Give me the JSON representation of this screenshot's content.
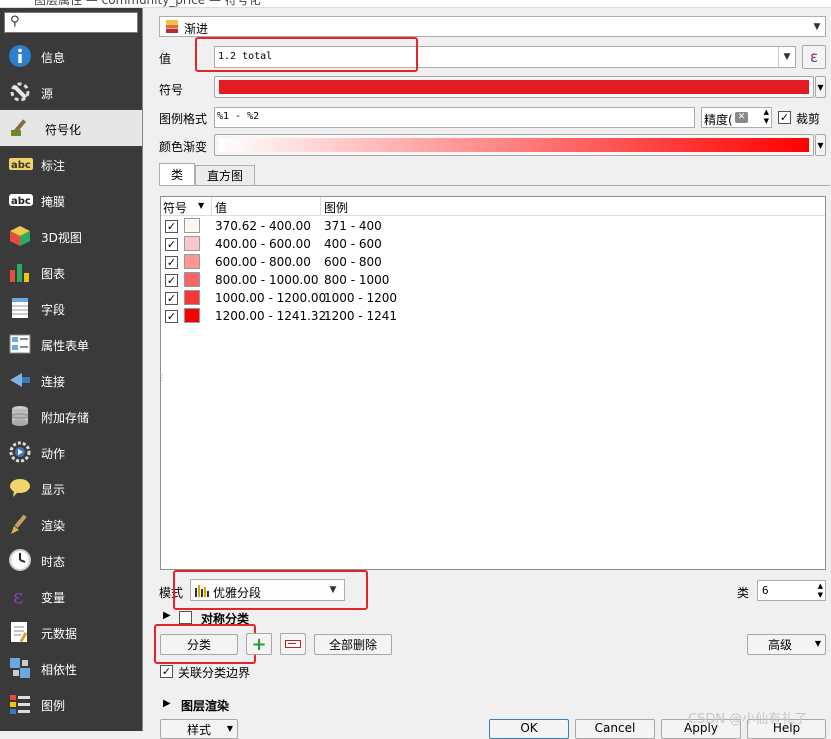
{
  "window": {
    "title_fragment": "图层属性 — community_price — 符号化"
  },
  "sidebar": {
    "search_placeholder": "",
    "items": [
      {
        "label": "信息",
        "icon": "info-icon"
      },
      {
        "label": "源",
        "icon": "source-wrench-icon"
      },
      {
        "label": "符号化",
        "icon": "symbology-brush-icon"
      },
      {
        "label": "标注",
        "icon": "labels-abc-icon"
      },
      {
        "label": "掩膜",
        "icon": "mask-abc-icon"
      },
      {
        "label": "3D视图",
        "icon": "3d-cube-icon"
      },
      {
        "label": "图表",
        "icon": "diagram-chart-icon"
      },
      {
        "label": "字段",
        "icon": "fields-table-icon"
      },
      {
        "label": "属性表单",
        "icon": "attributes-form-icon"
      },
      {
        "label": "连接",
        "icon": "joins-icon"
      },
      {
        "label": "附加存储",
        "icon": "auxiliary-storage-icon"
      },
      {
        "label": "动作",
        "icon": "actions-gear-icon"
      },
      {
        "label": "显示",
        "icon": "display-bubble-icon"
      },
      {
        "label": "渲染",
        "icon": "rendering-brush-icon"
      },
      {
        "label": "时态",
        "icon": "temporal-clock-icon"
      },
      {
        "label": "变量",
        "icon": "variables-epsilon-icon"
      },
      {
        "label": "元数据",
        "icon": "metadata-doc-icon"
      },
      {
        "label": "相依性",
        "icon": "dependencies-icon"
      },
      {
        "label": "图例",
        "icon": "legend-icon"
      }
    ],
    "active_index": 2
  },
  "renderer": {
    "label": "渐进"
  },
  "value": {
    "label": "值",
    "text": "1.2 total",
    "expr_icon": "ε"
  },
  "symbol": {
    "label": "符号",
    "color": "#e31b23"
  },
  "legend_format": {
    "label": "图例格式",
    "text": "%1 - %2",
    "precision_label": "精度(",
    "trim_label": "裁剪",
    "trim_checked": true
  },
  "color_ramp": {
    "label": "颜色渐变",
    "from": "#ffffff",
    "to": "#ff0000"
  },
  "tabs": [
    {
      "label": "类"
    },
    {
      "label": "直方图"
    }
  ],
  "table": {
    "headers": {
      "symbol": "符号",
      "value": "值",
      "legend": "图例"
    },
    "rows": [
      {
        "value": "370.62 - 400.00",
        "legend": "371 - 400",
        "color": "#fff5f5",
        "checked": true
      },
      {
        "value": "400.00 - 600.00",
        "legend": "400 - 600",
        "color": "#fcc6c6",
        "checked": true
      },
      {
        "value": "600.00 - 800.00",
        "legend": "600 - 800",
        "color": "#fa9797",
        "checked": true
      },
      {
        "value": "800.00 - 1000.00",
        "legend": "800 - 1000",
        "color": "#f76565",
        "checked": true
      },
      {
        "value": "1000.00 - 1200.00",
        "legend": "1000 - 1200",
        "color": "#f43636",
        "checked": true
      },
      {
        "value": "1200.00 - 1241.32",
        "legend": "1200 - 1241",
        "color": "#f00505",
        "checked": true
      }
    ]
  },
  "mode": {
    "label": "模式",
    "value": "优雅分段",
    "classes_label": "类",
    "classes_value": "6"
  },
  "symmetric": {
    "label": "对称分类"
  },
  "buttons": {
    "classify": "分类",
    "add": "+",
    "remove": "−",
    "delete_all": "全部删除",
    "advanced": "高级"
  },
  "link_boundaries": {
    "label": "关联分类边界",
    "checked": true
  },
  "layer_rendering": {
    "label": "图层渲染"
  },
  "bottom": {
    "style": "样式",
    "ok": "OK",
    "cancel": "Cancel",
    "apply": "Apply",
    "help": "Help"
  },
  "watermark": "CSDN @小仙有礼了"
}
